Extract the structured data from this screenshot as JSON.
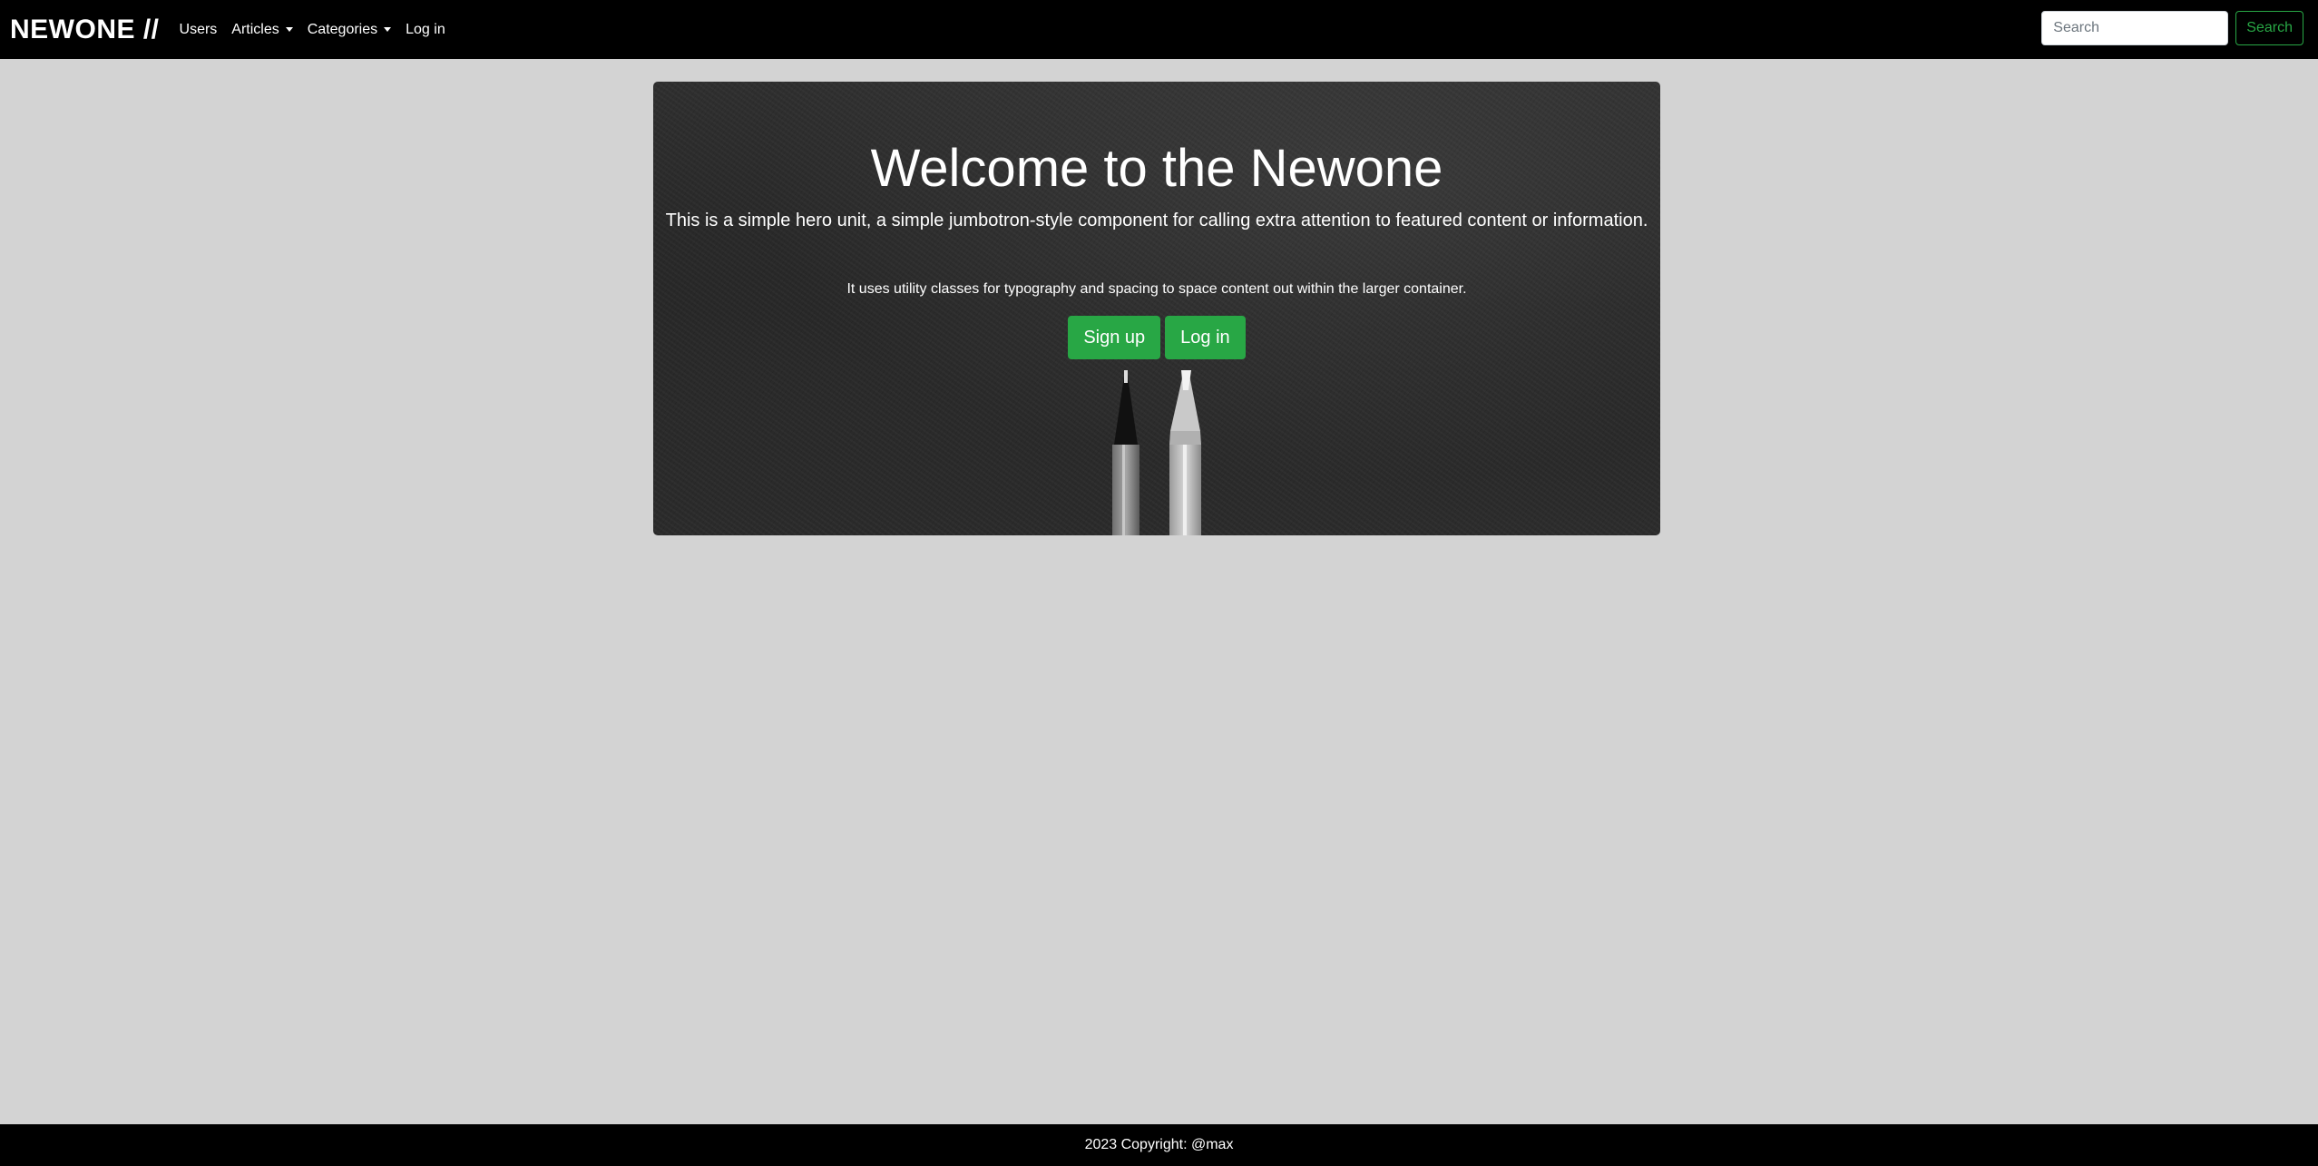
{
  "navbar": {
    "brand": "NEWONE //",
    "links": {
      "users": "Users",
      "articles": "Articles",
      "categories": "Categories",
      "login": "Log in"
    },
    "search": {
      "placeholder": "Search",
      "button_label": "Search"
    }
  },
  "hero": {
    "title": "Welcome to the Newone",
    "lead": "This is a simple hero unit, a simple jumbotron-style component for calling extra attention to featured content or information.",
    "text": "It uses utility classes for typography and spacing to space content out within the larger container.",
    "signup_label": "Sign up",
    "login_label": "Log in"
  },
  "footer": {
    "copyright": "2023 Copyright: @max"
  },
  "colors": {
    "nav_bg": "#000000",
    "page_bg": "#d3d3d3",
    "accent_green": "#28a745"
  }
}
